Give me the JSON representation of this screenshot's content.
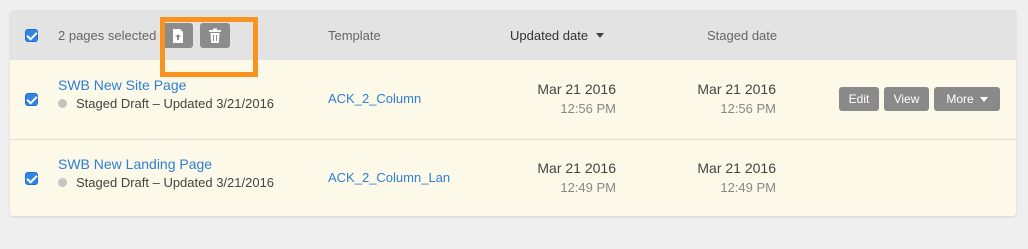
{
  "header": {
    "select_all_checked": true,
    "selection_label": "2 pages selected",
    "columns": {
      "template": "Template",
      "updated_date": "Updated date",
      "staged_date": "Staged date"
    },
    "bulk_actions": [
      {
        "name": "publish-icon"
      },
      {
        "name": "trash-icon"
      }
    ]
  },
  "rows": [
    {
      "checked": true,
      "title": "SWB New Site Page",
      "status": "Staged Draft – Updated 3/21/2016",
      "template": "ACK_2_Column",
      "updated_date": "Mar 21 2016",
      "updated_time": "12:56 PM",
      "staged_date": "Mar 21 2016",
      "staged_time": "12:56 PM",
      "actions": {
        "edit": "Edit",
        "view": "View",
        "more": "More"
      }
    },
    {
      "checked": true,
      "title": "SWB New Landing Page",
      "status": "Staged Draft – Updated 3/21/2016",
      "template": "ACK_2_Column_Lan",
      "updated_date": "Mar 21 2016",
      "updated_time": "12:49 PM",
      "staged_date": "Mar 21 2016",
      "staged_time": "12:49 PM"
    }
  ],
  "colors": {
    "accent": "#2f84e4",
    "highlight": "#f7931e",
    "row_background": "#fdf9e8",
    "header_background": "#e3e3e3",
    "link": "#2c7fd6"
  }
}
